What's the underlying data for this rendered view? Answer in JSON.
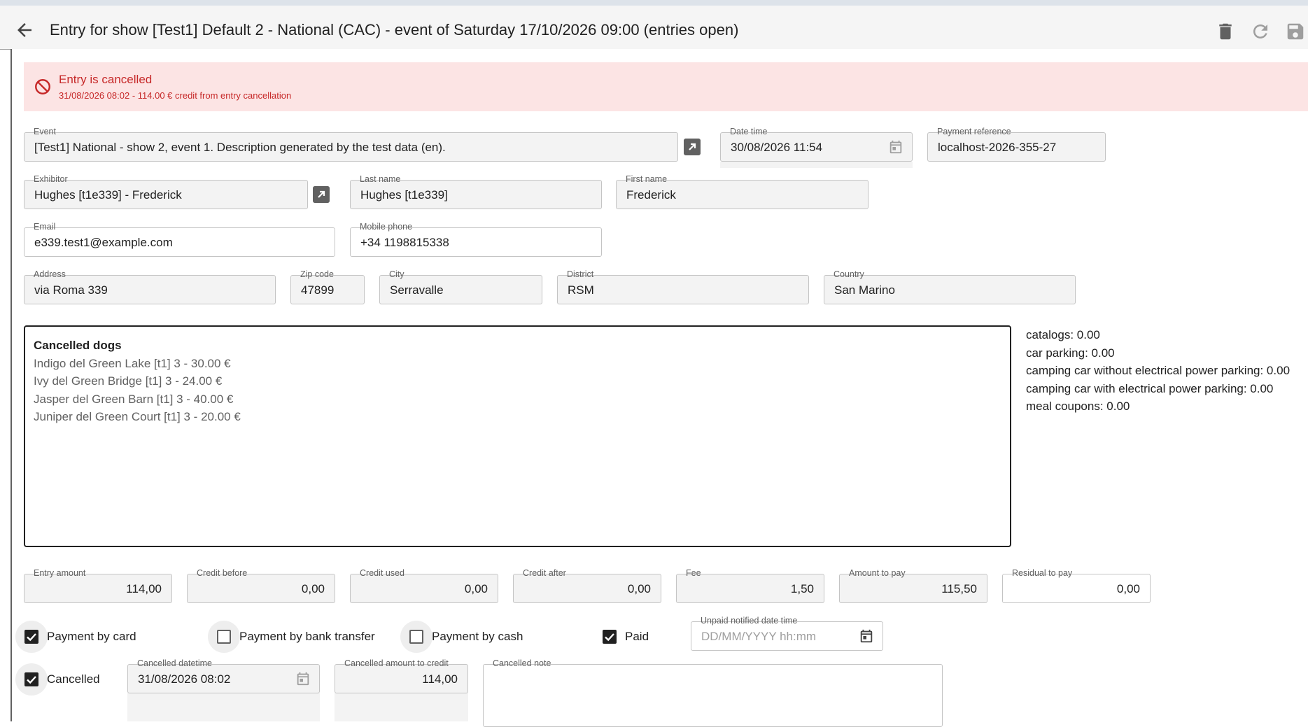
{
  "header": {
    "title": "Entry for show [Test1] Default 2 - National (CAC) - event of Saturday 17/10/2026 09:00 (entries open)",
    "back_icon": "arrow-back-icon",
    "delete_icon": "trash-icon",
    "undo_icon": "undo-icon",
    "save_icon": "save-icon"
  },
  "alert": {
    "title": "Entry is cancelled",
    "detail": "31/08/2026 08:02 - 114.00 € credit from entry cancellation",
    "color": "#c62828",
    "background": "#fce4e4"
  },
  "fields": {
    "event": {
      "label": "Event",
      "value": "[Test1] National - show 2, event 1. Description generated by the test data (en)."
    },
    "date_time": {
      "label": "Date time",
      "value": "30/08/2026 11:54"
    },
    "payment_reference": {
      "label": "Payment reference",
      "value": "localhost-2026-355-27"
    },
    "exhibitor": {
      "label": "Exhibitor",
      "value": "Hughes [t1e339] - Frederick"
    },
    "last_name": {
      "label": "Last name",
      "value": "Hughes [t1e339]"
    },
    "first_name": {
      "label": "First name",
      "value": "Frederick"
    },
    "email": {
      "label": "Email",
      "value": "e339.test1@example.com"
    },
    "mobile_phone": {
      "label": "Mobile phone",
      "value": "+34 1198815338"
    },
    "address": {
      "label": "Address",
      "value": "via Roma 339"
    },
    "zip_code": {
      "label": "Zip code",
      "value": "47899"
    },
    "city": {
      "label": "City",
      "value": "Serravalle"
    },
    "district": {
      "label": "District",
      "value": "RSM"
    },
    "country": {
      "label": "Country",
      "value": "San Marino"
    }
  },
  "dogs": {
    "heading": "Cancelled dogs",
    "items": [
      "Indigo del Green Lake [t1] 3 - 30.00 €",
      "Ivy del Green Bridge [t1] 3 - 24.00 €",
      "Jasper del Green Barn [t1] 3 - 40.00 €",
      "Juniper del Green Court [t1] 3 - 20.00 €"
    ]
  },
  "extras": [
    "catalogs: 0.00",
    "car parking: 0.00",
    "camping car without electrical power parking: 0.00",
    "camping car with electrical power parking: 0.00",
    "meal coupons: 0.00"
  ],
  "amounts": {
    "entry_amount": {
      "label": "Entry amount",
      "value": "114,00"
    },
    "credit_before": {
      "label": "Credit before",
      "value": "0,00"
    },
    "credit_used": {
      "label": "Credit used",
      "value": "0,00"
    },
    "credit_after": {
      "label": "Credit after",
      "value": "0,00"
    },
    "fee": {
      "label": "Fee",
      "value": "1,50"
    },
    "amount_to_pay": {
      "label": "Amount to pay",
      "value": "115,50"
    },
    "residual_to_pay": {
      "label": "Residual to pay",
      "value": "0,00"
    }
  },
  "payment": {
    "card": {
      "label": "Payment by card",
      "checked": true
    },
    "bank_transfer": {
      "label": "Payment by bank transfer",
      "checked": false
    },
    "cash": {
      "label": "Payment by cash",
      "checked": false
    },
    "paid": {
      "label": "Paid",
      "checked": true
    },
    "unpaid_notified": {
      "label": "Unpaid notified date time",
      "placeholder": "DD/MM/YYYY hh:mm"
    }
  },
  "cancellation": {
    "cancelled": {
      "label": "Cancelled",
      "checked": true
    },
    "cancelled_datetime": {
      "label": "Cancelled datetime",
      "value": "31/08/2026 08:02"
    },
    "cancelled_amount": {
      "label": "Cancelled amount to credit",
      "value": "114,00"
    },
    "cancelled_note": {
      "label": "Cancelled note",
      "value": ""
    }
  }
}
